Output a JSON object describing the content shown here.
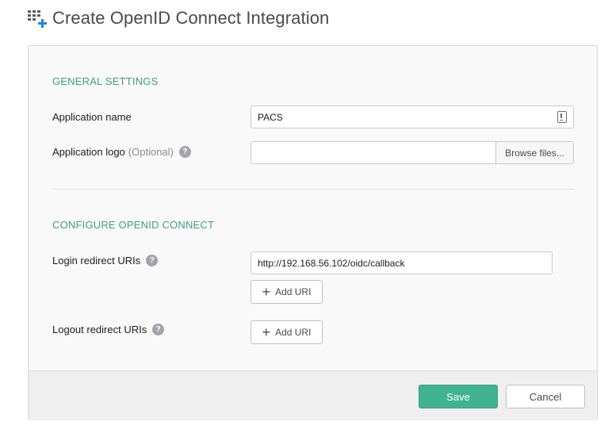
{
  "header": {
    "title": "Create OpenID Connect Integration",
    "icon": "grid-plus-icon"
  },
  "general": {
    "section_title": "GENERAL SETTINGS",
    "app_name_label": "Application name",
    "app_name_value": "PACS",
    "app_logo_label": "Application logo",
    "app_logo_optional": "(Optional)",
    "app_logo_value": "",
    "browse_label": "Browse files..."
  },
  "oidc": {
    "section_title": "CONFIGURE OPENID CONNECT",
    "login_label": "Login redirect URIs",
    "login_uri_value": "http://192.168.56.102/oidc/callback",
    "add_uri_label": "Add URI",
    "logout_label": "Logout redirect URIs"
  },
  "help_glyph": "?",
  "footer": {
    "save_label": "Save",
    "cancel_label": "Cancel"
  },
  "colors": {
    "accent": "#3fb48f",
    "section": "#3e9e85",
    "icon_plus": "#1a8ad6"
  }
}
